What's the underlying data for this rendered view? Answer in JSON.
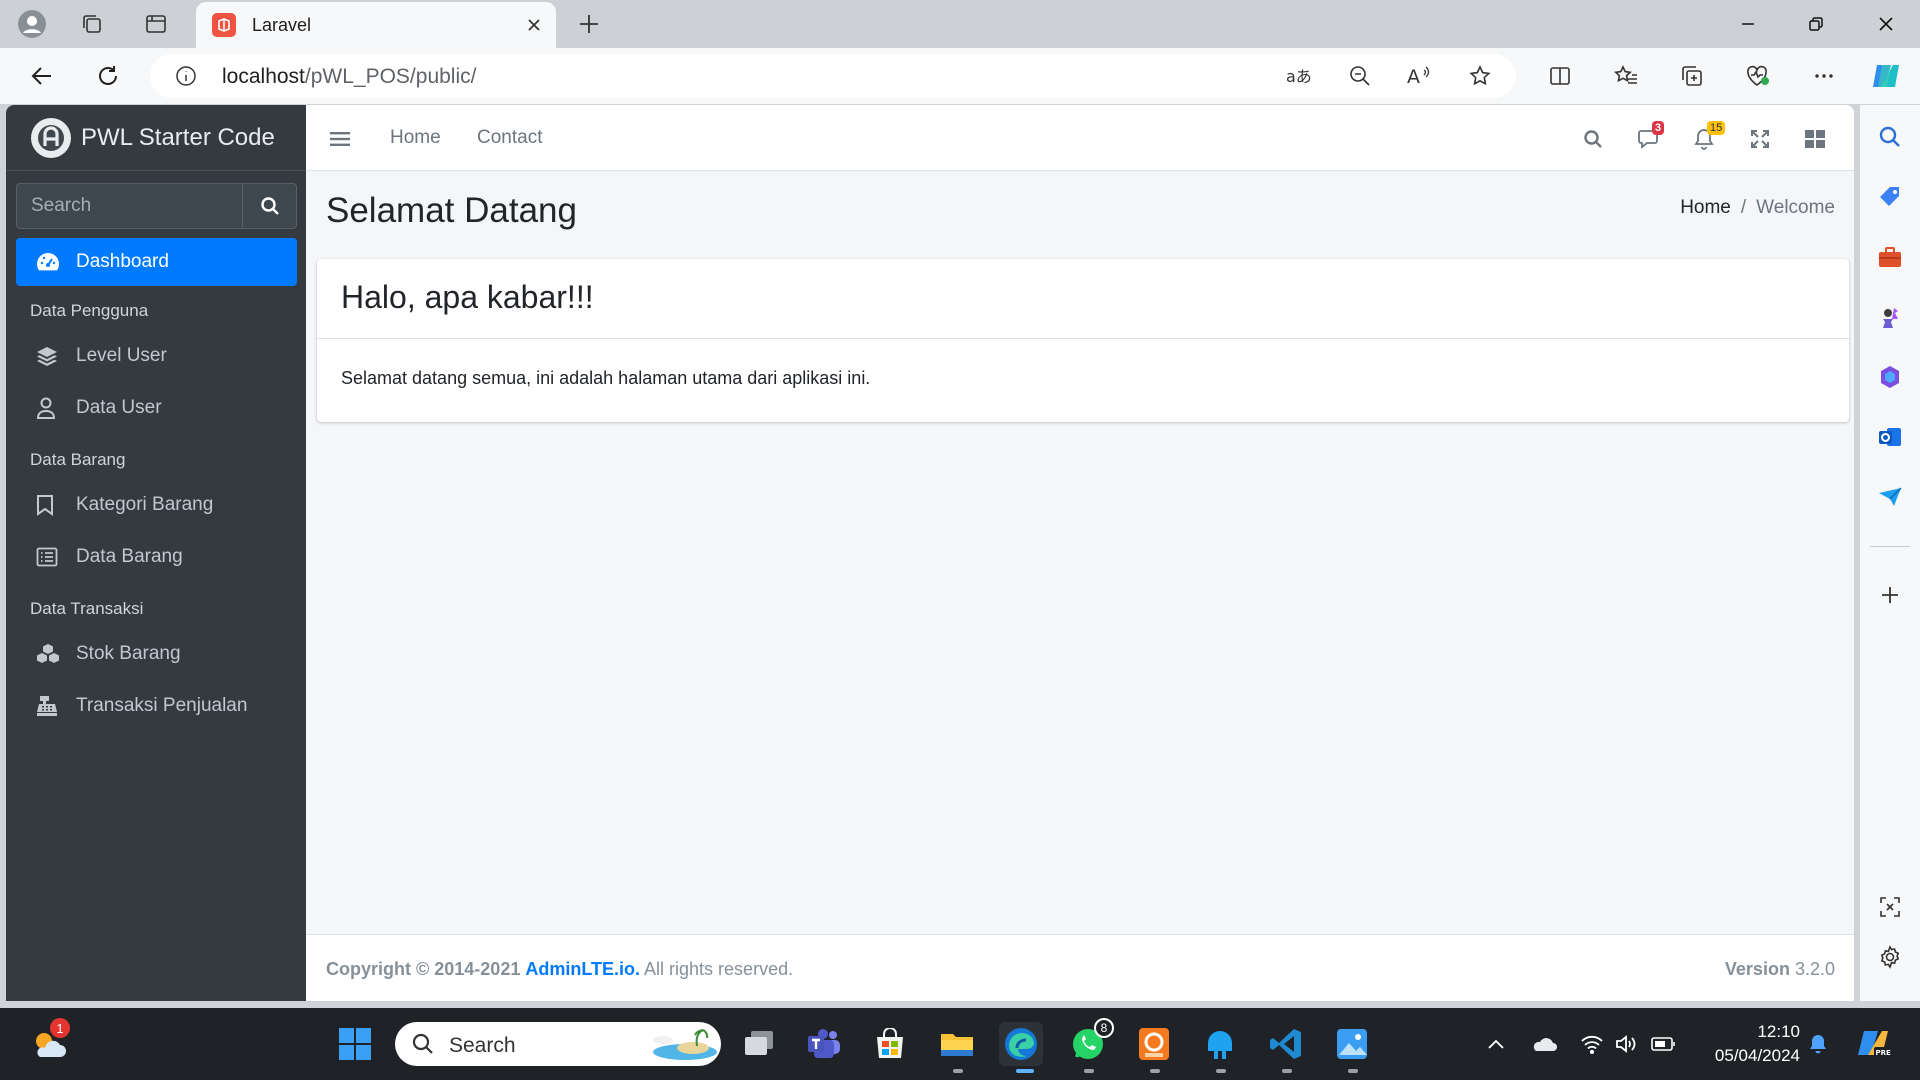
{
  "browser": {
    "tab_title": "Laravel",
    "url_host": "localhost",
    "url_path": "/pWL_POS/public/"
  },
  "sidebar": {
    "brand": "PWL Starter Code",
    "search_placeholder": "Search",
    "active_item": "Dashboard",
    "groups": [
      {
        "header": "Data Pengguna",
        "items": [
          "Level User",
          "Data User"
        ]
      },
      {
        "header": "Data Barang",
        "items": [
          "Kategori Barang",
          "Data Barang"
        ]
      },
      {
        "header": "Data Transaksi",
        "items": [
          "Stok Barang",
          "Transaksi Penjualan"
        ]
      }
    ]
  },
  "topnav": {
    "links": [
      "Home",
      "Contact"
    ],
    "messages_count": "3",
    "notifications_count": "15"
  },
  "content": {
    "page_title": "Selamat Datang",
    "breadcrumb_home": "Home",
    "breadcrumb_sep": "/",
    "breadcrumb_current": "Welcome",
    "card_title": "Halo, apa kabar!!!",
    "card_body": "Selamat datang semua, ini adalah halaman utama dari aplikasi ini."
  },
  "footer": {
    "copyright_prefix": "Copyright © 2014-2021",
    "copyright_link": "AdminLTE.io.",
    "copyright_suffix": "All rights reserved.",
    "version_label": "Version",
    "version_number": "3.2.0"
  },
  "taskbar": {
    "search_label": "Search",
    "time": "12:10",
    "date": "05/04/2024",
    "weather_badge": "1",
    "whatsapp_badge": "8"
  },
  "colors": {
    "accent": "#007bff",
    "sidebar_bg": "#343a40",
    "content_bg": "#f4f6f9"
  }
}
